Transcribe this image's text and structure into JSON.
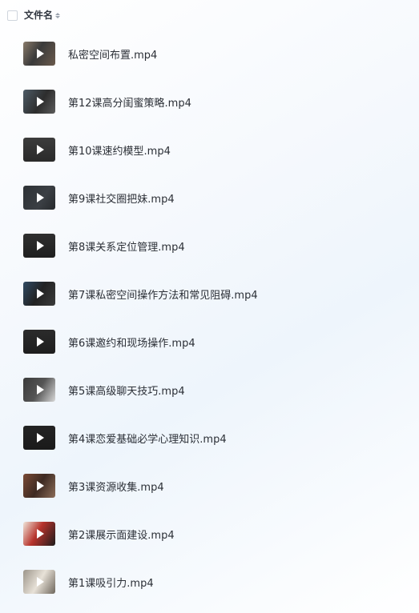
{
  "header": {
    "column_label": "文件名",
    "sort_icon": "sort-arrows-icon"
  },
  "files": [
    {
      "name": "私密空间布置.mp4",
      "icon": "video-thumbnail-icon"
    },
    {
      "name": "第12课高分闺蜜策略.mp4",
      "icon": "video-thumbnail-icon"
    },
    {
      "name": "第10课速约模型.mp4",
      "icon": "video-thumbnail-icon"
    },
    {
      "name": "第9课社交圈把妹.mp4",
      "icon": "video-thumbnail-icon"
    },
    {
      "name": "第8课关系定位管理.mp4",
      "icon": "video-thumbnail-icon"
    },
    {
      "name": "第7课私密空间操作方法和常见阻碍.mp4",
      "icon": "video-thumbnail-icon"
    },
    {
      "name": "第6课邀约和现场操作.mp4",
      "icon": "video-thumbnail-icon"
    },
    {
      "name": "第5课高级聊天技巧.mp4",
      "icon": "video-thumbnail-icon"
    },
    {
      "name": "第4课恋爱基础必学心理知识.mp4",
      "icon": "video-thumbnail-icon"
    },
    {
      "name": "第3课资源收集.mp4",
      "icon": "video-thumbnail-icon"
    },
    {
      "name": "第2课展示面建设.mp4",
      "icon": "video-thumbnail-icon"
    },
    {
      "name": "第1课吸引力.mp4",
      "icon": "video-thumbnail-icon"
    }
  ]
}
